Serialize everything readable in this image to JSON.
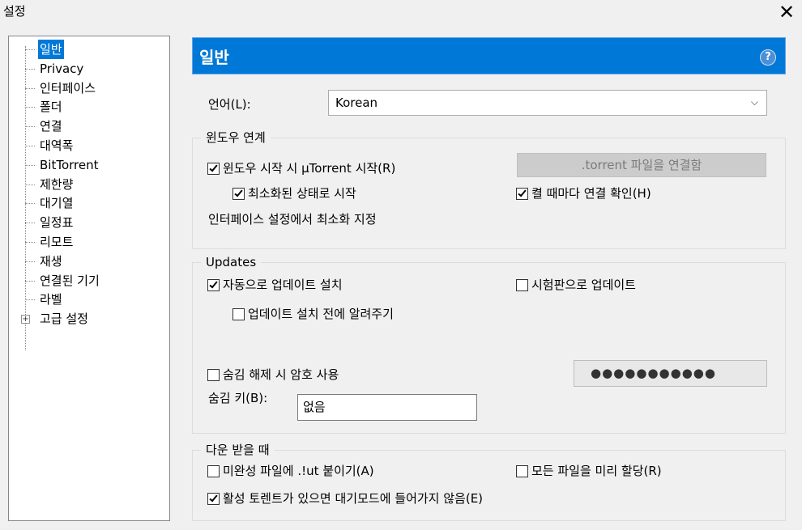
{
  "window": {
    "title": "설정",
    "close_glyph": "✕"
  },
  "tree": {
    "items": [
      {
        "label": "일반",
        "selected": true
      },
      {
        "label": "Privacy"
      },
      {
        "label": "인터페이스"
      },
      {
        "label": "폴더"
      },
      {
        "label": "연결"
      },
      {
        "label": "대역폭"
      },
      {
        "label": "BitTorrent"
      },
      {
        "label": "제한량"
      },
      {
        "label": "대기열"
      },
      {
        "label": "일정표"
      },
      {
        "label": "리모트"
      },
      {
        "label": "재생"
      },
      {
        "label": "연결된 기기"
      },
      {
        "label": "라벨"
      },
      {
        "label": "고급 설정",
        "expander": "+"
      }
    ]
  },
  "header": {
    "title": "일반",
    "help_glyph": "?"
  },
  "language": {
    "label": "언어(L):",
    "value": "Korean",
    "chevron": "⌵"
  },
  "windows_integration": {
    "legend": "윈도우 연계",
    "start_with_windows": {
      "label": "윈도우 시작 시 µTorrent 시작(R)",
      "checked": true
    },
    "start_minimized": {
      "label": "최소화된 상태로 시작",
      "checked": true
    },
    "associate_button": ".torrent 파일을 연결함",
    "check_association": {
      "label": "켤 때마다 연결 확인(H)",
      "checked": true
    },
    "minimize_note": "인터페이스 설정에서 최소화 지정"
  },
  "updates": {
    "legend": "Updates",
    "auto_install": {
      "label": "자동으로 업데이트 설치",
      "checked": true
    },
    "beta_updates": {
      "label": "시험판으로 업데이트",
      "checked": false
    },
    "notify_before": {
      "label": "업데이트 설치 전에 알려주기",
      "checked": false
    },
    "password_on_unhide": {
      "label": "숨김 해제 시 암호 사용",
      "checked": false
    },
    "password_value": "●●●●●●●●●●●",
    "boss_key_label": "숨김 키(B):",
    "boss_key_value": "없음"
  },
  "downloading": {
    "legend": "다운 받을 때",
    "append_ut": {
      "label": "미완성 파일에 .!ut 붙이기(A)",
      "checked": false
    },
    "preallocate": {
      "label": "모든 파일을 미리 할당(R)",
      "checked": false
    },
    "prevent_standby": {
      "label": "활성 토렌트가 있으면 대기모드에 들어가지 않음(E)",
      "checked": true
    }
  }
}
